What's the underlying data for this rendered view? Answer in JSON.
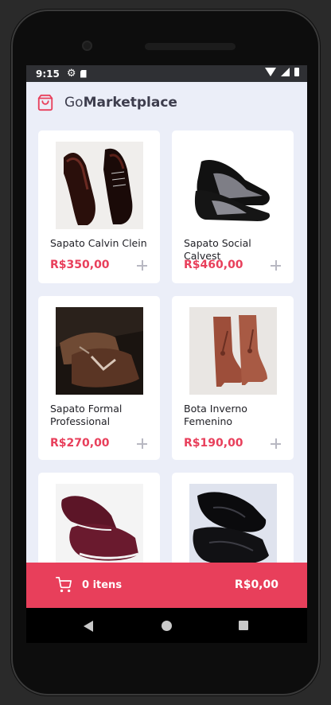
{
  "status_bar": {
    "time": "9:15"
  },
  "header": {
    "brand_prefix": "Go",
    "brand_bold": "Marketplace"
  },
  "products": [
    {
      "name": "Sapato Calvin Clein",
      "price": "R$350,00",
      "image": "dark-brown-oxford-shoes"
    },
    {
      "name": "Sapato Social Calvest",
      "price": "R$460,00",
      "image": "black-sequin-loafers"
    },
    {
      "name": "Sapato Formal Professional",
      "price": "R$270,00",
      "image": "brown-buckle-shoes"
    },
    {
      "name": "Bota Inverno Femenino",
      "price": "R$190,00",
      "image": "brown-suede-ankle-boots"
    },
    {
      "name": "",
      "price": "",
      "image": "burgundy-sneakers"
    },
    {
      "name": "",
      "price": "",
      "image": "black-sneakers"
    }
  ],
  "cart": {
    "items_label": "0 itens",
    "total": "R$0,00"
  },
  "colors": {
    "accent": "#e83f5b",
    "background": "#ebeef8",
    "card": "#ffffff"
  },
  "icons": [
    "settings-icon",
    "sdcard-icon",
    "wifi-icon",
    "signal-icon",
    "battery-icon",
    "shopping-bag-icon",
    "plus-icon",
    "cart-icon",
    "back-icon",
    "home-icon",
    "recents-icon"
  ]
}
